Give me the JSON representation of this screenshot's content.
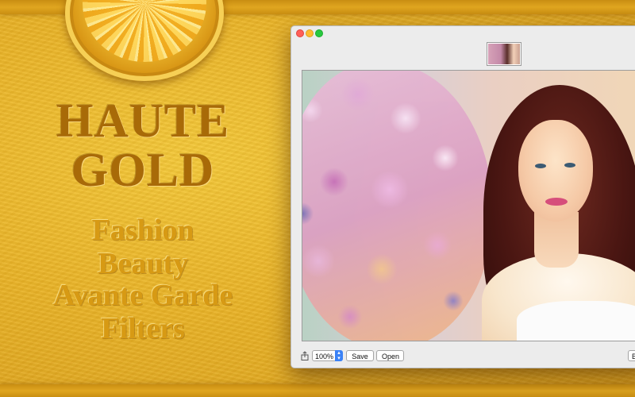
{
  "promo": {
    "brand_line1": "HAUTE",
    "brand_line2": "GOLD",
    "taglines": [
      "Fashion",
      "Beauty",
      "Avante Garde",
      "Filters"
    ]
  },
  "window": {
    "preview_caption": "",
    "toolbar": {
      "zoom_value": "100%",
      "save_label": "Save",
      "open_label": "Open",
      "truncated_label": "Br"
    }
  },
  "colors": {
    "gold_dark": "#a86a08",
    "gold_light": "#d79a14",
    "accent_blue": "#3b82f6"
  },
  "icons": {
    "share": "share-icon",
    "zoom_stepper": "chevron-updown-icon"
  }
}
